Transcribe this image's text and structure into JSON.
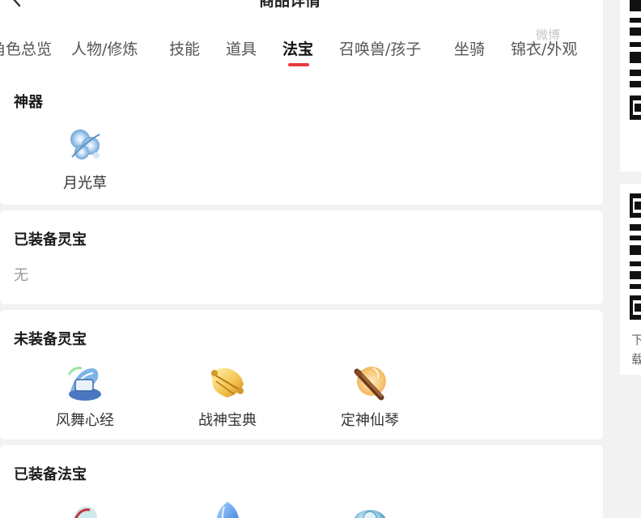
{
  "header": {
    "title": "商品详情",
    "back_icon": "chevron-left-icon",
    "share_icon": "share-icon",
    "cart_icon": "cart-icon",
    "more_icon": "more-vertical-icon"
  },
  "watermark": "微博",
  "tabs": [
    {
      "label": "角色总览",
      "active": false
    },
    {
      "label": "人物/修炼",
      "active": false
    },
    {
      "label": "技能",
      "active": false
    },
    {
      "label": "道具",
      "active": false
    },
    {
      "label": "法宝",
      "active": true
    },
    {
      "label": "召唤兽/孩子",
      "active": false
    },
    {
      "label": "坐骑",
      "active": false
    },
    {
      "label": "锦衣/外观",
      "active": false
    }
  ],
  "accent_color": "#e8393d",
  "sections": {
    "artifact": {
      "title": "神器",
      "items": [
        {
          "label": "月光草",
          "icon": "moonlight-grass-icon"
        }
      ]
    },
    "equipped_lingbao": {
      "title": "已装备灵宝",
      "empty_text": "无"
    },
    "unequipped_lingbao": {
      "title": "未装备灵宝",
      "items": [
        {
          "label": "风舞心经",
          "icon": "wind-dance-scripture-icon"
        },
        {
          "label": "战神宝典",
          "icon": "war-god-scroll-icon"
        },
        {
          "label": "定神仙琴",
          "icon": "immortal-zither-icon"
        }
      ]
    },
    "equipped_fabao": {
      "title": "已装备法宝",
      "items": [
        {
          "icon": "fabao-dragon-icon"
        },
        {
          "icon": "fabao-crystal-icon"
        },
        {
          "icon": "fabao-orb-icon"
        }
      ]
    }
  },
  "side": {
    "text_line1": "下",
    "text_line2": "载"
  }
}
